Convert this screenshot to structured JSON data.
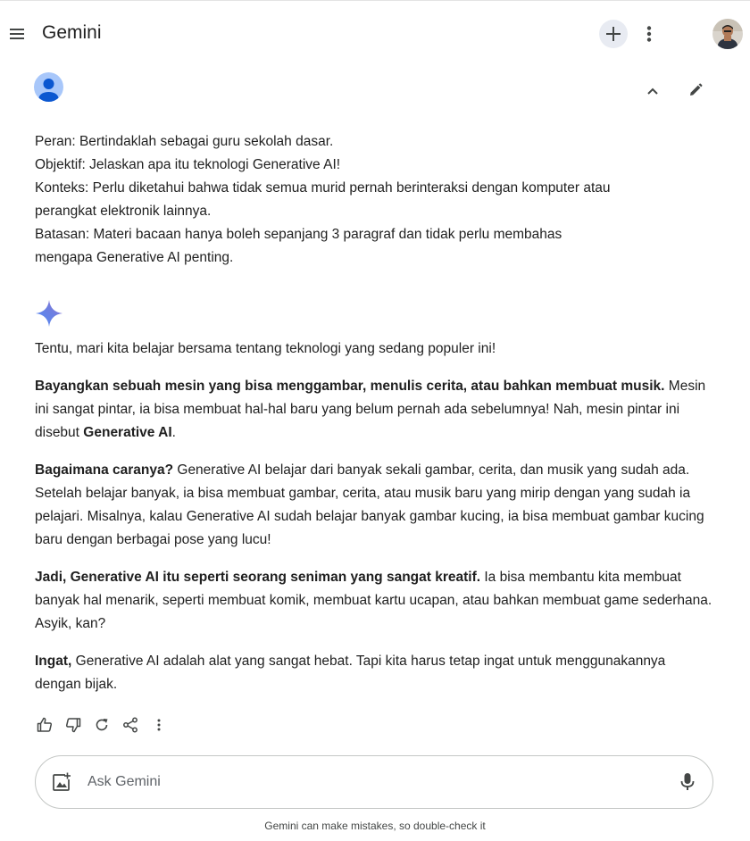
{
  "header": {
    "title": "Gemini",
    "icons": {
      "menu": "hamburger-menu-icon",
      "new_chat": "plus-icon",
      "more": "vertical-dots-icon"
    }
  },
  "prompt": {
    "lines": [
      "Peran: Bertindaklah sebagai guru sekolah dasar.",
      "Objektif: Jelaskan apa itu teknologi Generative AI!",
      "Konteks: Perlu diketahui bahwa tidak semua murid pernah berinteraksi dengan komputer atau",
      "perangkat elektronik lainnya.",
      "Batasan: Materi bacaan hanya boleh sepanjang 3 paragraf dan tidak perlu membahas",
      "mengapa Generative AI penting."
    ]
  },
  "response": {
    "intro": "Tentu, mari kita belajar bersama tentang teknologi yang sedang populer ini!",
    "p1": {
      "bold": "Bayangkan sebuah mesin yang bisa menggambar, menulis cerita, atau bahkan membuat musik.",
      "text": " Mesin ini sangat pintar, ia bisa membuat hal-hal baru yang belum pernah ada sebelumnya! Nah, mesin pintar ini disebut ",
      "bold2": "Generative AI",
      "end": "."
    },
    "p2": {
      "bold": "Bagaimana caranya?",
      "text": " Generative AI belajar dari banyak sekali gambar, cerita, dan musik yang sudah ada. Setelah belajar banyak, ia bisa membuat gambar, cerita, atau musik baru yang mirip dengan yang sudah ia pelajari. Misalnya, kalau Generative AI sudah belajar banyak gambar kucing, ia bisa membuat gambar kucing baru dengan berbagai pose yang lucu!"
    },
    "p3": {
      "bold": "Jadi, Generative AI itu seperti seorang seniman yang sangat kreatif.",
      "text": " Ia bisa membantu kita membuat banyak hal menarik, seperti membuat komik, membuat kartu ucapan, atau bahkan membuat game sederhana. Asyik, kan?"
    },
    "p4": {
      "bold": "Ingat,",
      "text": " Generative AI adalah alat yang sangat hebat. Tapi kita harus tetap ingat untuk menggunakannya dengan bijak."
    }
  },
  "actions": [
    "thumbs-up-icon",
    "thumbs-down-icon",
    "regenerate-icon",
    "share-icon",
    "more-icon"
  ],
  "input": {
    "placeholder": "Ask Gemini"
  },
  "footer": {
    "disclaimer": "Gemini can make mistakes, so double-check it"
  },
  "colors": {
    "accent_bg": "#e8ebf2",
    "user_avatar": "#a8c7fa",
    "spark_blue": "#4f8df7",
    "spark_purple": "#9b72cb"
  }
}
